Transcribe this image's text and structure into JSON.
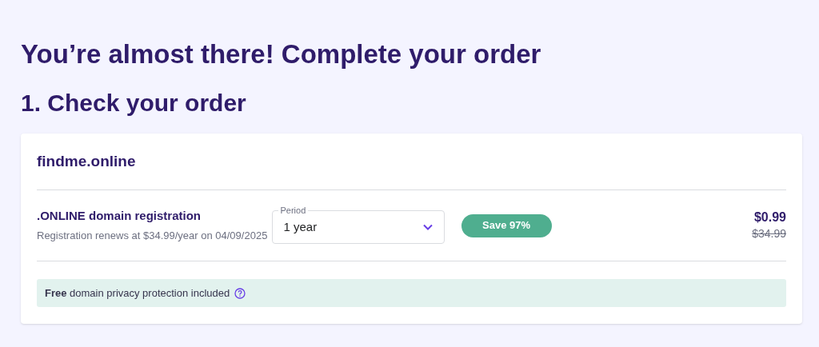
{
  "heading": "You’re almost there! Complete your order",
  "step_title": "1. Check your order",
  "order": {
    "domain": "findme.online",
    "item": {
      "name": ".ONLINE domain registration",
      "renewal_note": "Registration renews at $34.99/year on 04/09/2025"
    },
    "period": {
      "label": "Period",
      "value": "1 year"
    },
    "discount_badge": "Save 97%",
    "price": "$0.99",
    "old_price": "$34.99",
    "privacy_note": "**Free** domain privacy protection included"
  }
}
